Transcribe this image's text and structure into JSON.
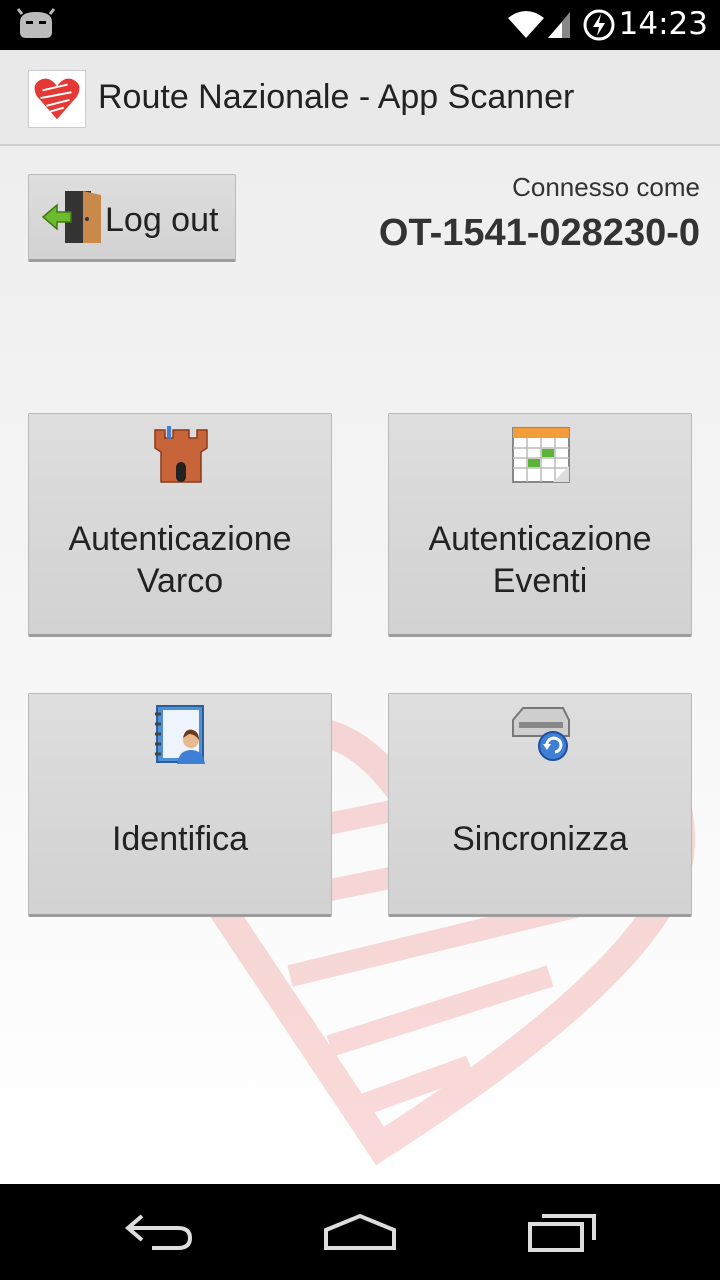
{
  "status_bar": {
    "time": "14:23",
    "icons": [
      "android-icon",
      "wifi-icon",
      "signal-icon",
      "battery-charging-icon"
    ]
  },
  "action_bar": {
    "title": "Route Nazionale - App Scanner",
    "logo_icon": "heart-logo-icon"
  },
  "header": {
    "logout_label": "Log out",
    "connected_as_label": "Connesso come",
    "user_code": "OT-1541-028230-0"
  },
  "tiles": [
    {
      "line1": "Autenticazione",
      "line2": "Varco",
      "icon": "castle-icon"
    },
    {
      "line1": "Autenticazione",
      "line2": "Eventi",
      "icon": "calendar-icon"
    },
    {
      "label": "Identifica",
      "icon": "contact-book-icon"
    },
    {
      "label": "Sincronizza",
      "icon": "sync-drive-icon"
    }
  ],
  "nav_bar": {
    "icons": [
      "back-icon",
      "home-icon",
      "recent-apps-icon"
    ]
  },
  "colors": {
    "action_bar_bg": "#e9e9e9",
    "button_bg": "#d6d6d6",
    "watermark": "#e53935"
  }
}
